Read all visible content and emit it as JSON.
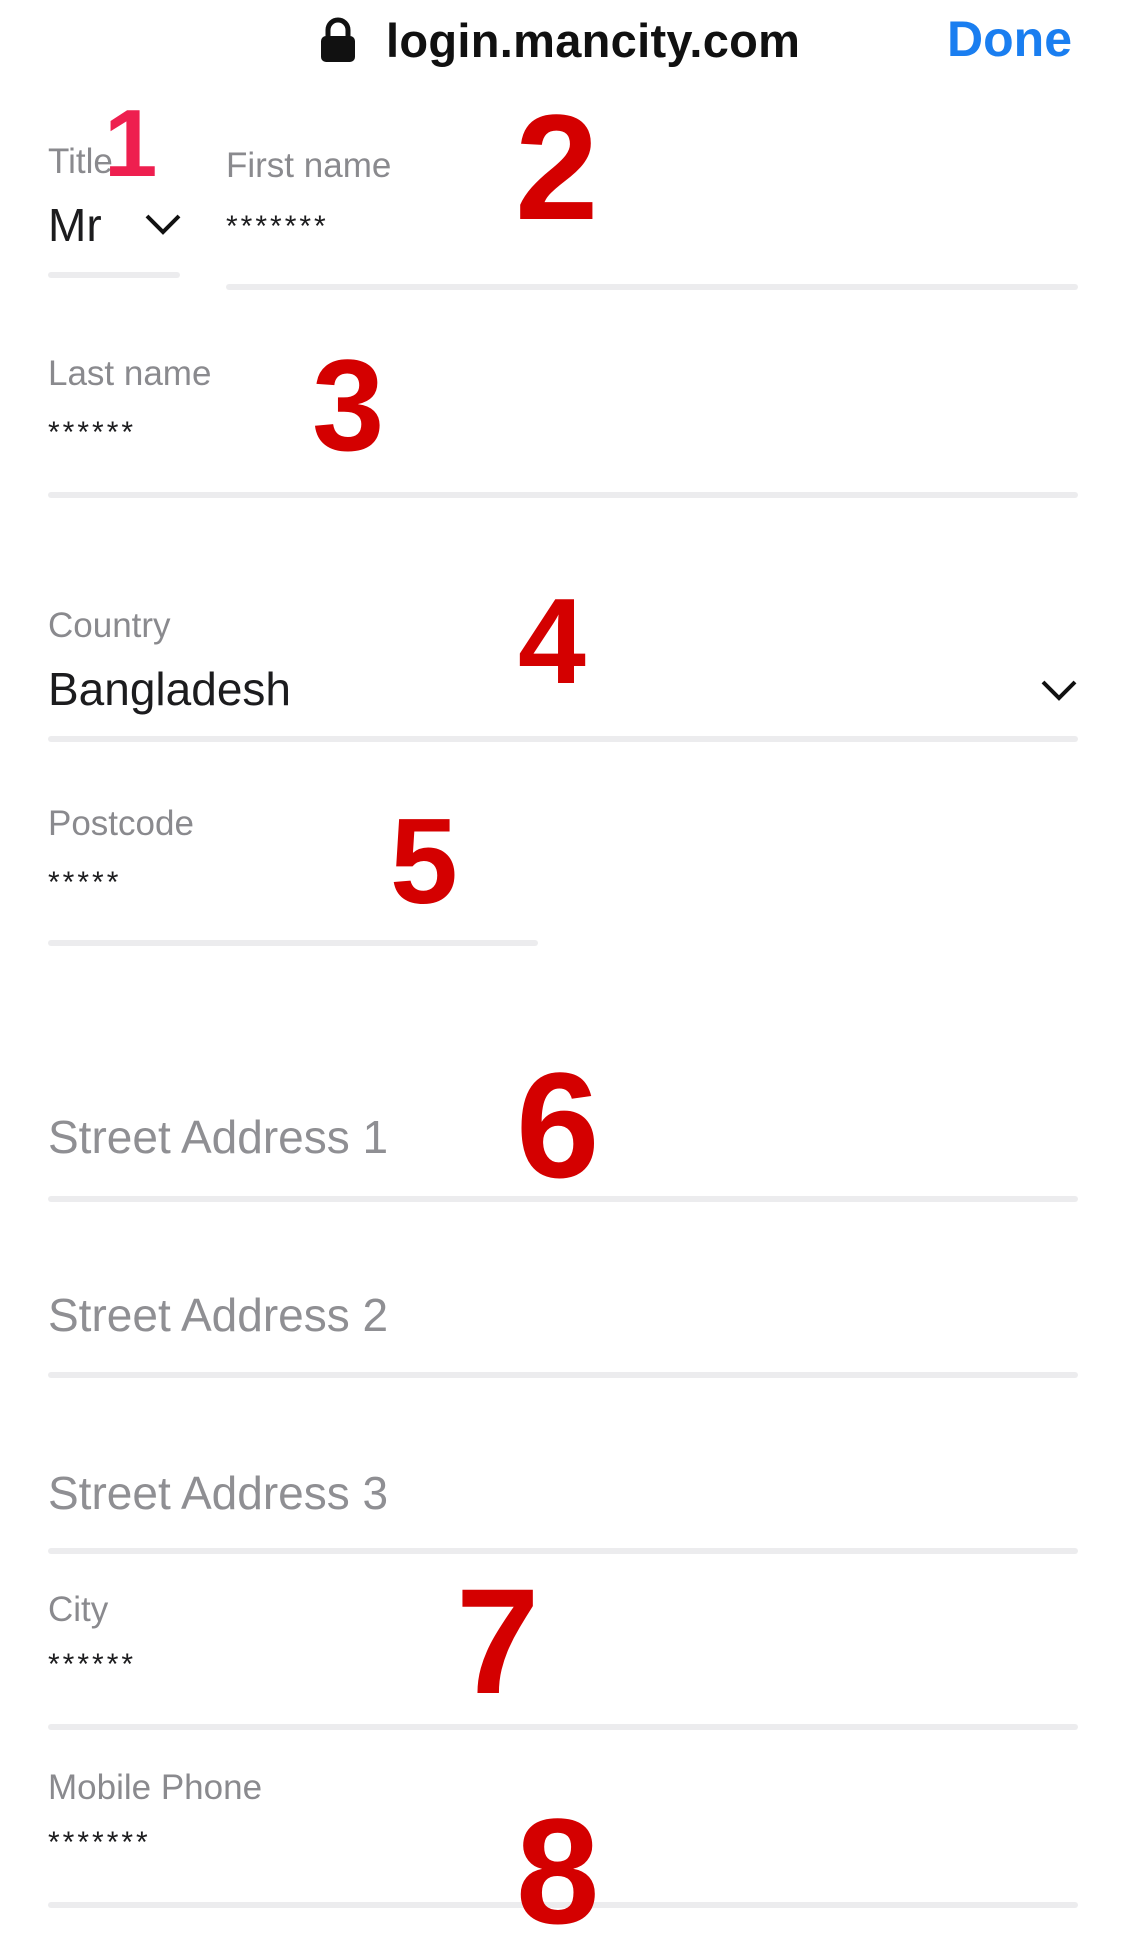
{
  "browser": {
    "url": "login.mancity.com",
    "done_label": "Done",
    "lock_icon": "lock-icon"
  },
  "form": {
    "title": {
      "label": "Title",
      "value": "Mr"
    },
    "first_name": {
      "label": "First name",
      "value": "*******"
    },
    "last_name": {
      "label": "Last name",
      "value": "******"
    },
    "country": {
      "label": "Country",
      "value": "Bangladesh"
    },
    "postcode": {
      "label": "Postcode",
      "value": "*****"
    },
    "street1": {
      "placeholder": "Street Address 1"
    },
    "street2": {
      "placeholder": "Street Address 2"
    },
    "street3": {
      "placeholder": "Street Address 3"
    },
    "city": {
      "label": "City",
      "value": "******"
    },
    "mobile": {
      "label": "Mobile Phone",
      "value": "*******"
    }
  },
  "annotations": [
    "1",
    "2",
    "3",
    "4",
    "5",
    "6",
    "7",
    "8"
  ],
  "colors": {
    "accent": "#1a7ef0",
    "annotation_red": "#d40000",
    "annotation_pink": "#ee1f4f",
    "label_gray": "#8a8a8e"
  }
}
